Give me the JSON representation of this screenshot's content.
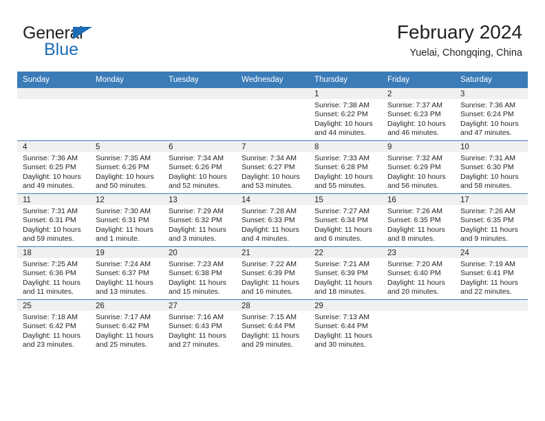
{
  "brand": {
    "name_part1": "General",
    "name_part2": "Blue",
    "triangle_color": "#1b6cb5",
    "text_color": "#231f20"
  },
  "header": {
    "title": "February 2024",
    "subtitle": "Yuelai, Chongqing, China"
  },
  "theme": {
    "header_bg": "#3b7cb8",
    "header_text": "#ffffff",
    "daynum_bg": "#f0f0f0",
    "cell_bg": "#ffffff",
    "grid_line": "#3b7cb8",
    "body_text": "#231f20"
  },
  "weekday_headers": [
    "Sunday",
    "Monday",
    "Tuesday",
    "Wednesday",
    "Thursday",
    "Friday",
    "Saturday"
  ],
  "weeks": [
    [
      {
        "day": "",
        "empty": true
      },
      {
        "day": "",
        "empty": true
      },
      {
        "day": "",
        "empty": true
      },
      {
        "day": "",
        "empty": true
      },
      {
        "day": "1",
        "sunrise": "Sunrise: 7:38 AM",
        "sunset": "Sunset: 6:22 PM",
        "daylight": "Daylight: 10 hours and 44 minutes."
      },
      {
        "day": "2",
        "sunrise": "Sunrise: 7:37 AM",
        "sunset": "Sunset: 6:23 PM",
        "daylight": "Daylight: 10 hours and 46 minutes."
      },
      {
        "day": "3",
        "sunrise": "Sunrise: 7:36 AM",
        "sunset": "Sunset: 6:24 PM",
        "daylight": "Daylight: 10 hours and 47 minutes."
      }
    ],
    [
      {
        "day": "4",
        "sunrise": "Sunrise: 7:36 AM",
        "sunset": "Sunset: 6:25 PM",
        "daylight": "Daylight: 10 hours and 49 minutes."
      },
      {
        "day": "5",
        "sunrise": "Sunrise: 7:35 AM",
        "sunset": "Sunset: 6:26 PM",
        "daylight": "Daylight: 10 hours and 50 minutes."
      },
      {
        "day": "6",
        "sunrise": "Sunrise: 7:34 AM",
        "sunset": "Sunset: 6:26 PM",
        "daylight": "Daylight: 10 hours and 52 minutes."
      },
      {
        "day": "7",
        "sunrise": "Sunrise: 7:34 AM",
        "sunset": "Sunset: 6:27 PM",
        "daylight": "Daylight: 10 hours and 53 minutes."
      },
      {
        "day": "8",
        "sunrise": "Sunrise: 7:33 AM",
        "sunset": "Sunset: 6:28 PM",
        "daylight": "Daylight: 10 hours and 55 minutes."
      },
      {
        "day": "9",
        "sunrise": "Sunrise: 7:32 AM",
        "sunset": "Sunset: 6:29 PM",
        "daylight": "Daylight: 10 hours and 56 minutes."
      },
      {
        "day": "10",
        "sunrise": "Sunrise: 7:31 AM",
        "sunset": "Sunset: 6:30 PM",
        "daylight": "Daylight: 10 hours and 58 minutes."
      }
    ],
    [
      {
        "day": "11",
        "sunrise": "Sunrise: 7:31 AM",
        "sunset": "Sunset: 6:31 PM",
        "daylight": "Daylight: 10 hours and 59 minutes."
      },
      {
        "day": "12",
        "sunrise": "Sunrise: 7:30 AM",
        "sunset": "Sunset: 6:31 PM",
        "daylight": "Daylight: 11 hours and 1 minute."
      },
      {
        "day": "13",
        "sunrise": "Sunrise: 7:29 AM",
        "sunset": "Sunset: 6:32 PM",
        "daylight": "Daylight: 11 hours and 3 minutes."
      },
      {
        "day": "14",
        "sunrise": "Sunrise: 7:28 AM",
        "sunset": "Sunset: 6:33 PM",
        "daylight": "Daylight: 11 hours and 4 minutes."
      },
      {
        "day": "15",
        "sunrise": "Sunrise: 7:27 AM",
        "sunset": "Sunset: 6:34 PM",
        "daylight": "Daylight: 11 hours and 6 minutes."
      },
      {
        "day": "16",
        "sunrise": "Sunrise: 7:26 AM",
        "sunset": "Sunset: 6:35 PM",
        "daylight": "Daylight: 11 hours and 8 minutes."
      },
      {
        "day": "17",
        "sunrise": "Sunrise: 7:26 AM",
        "sunset": "Sunset: 6:35 PM",
        "daylight": "Daylight: 11 hours and 9 minutes."
      }
    ],
    [
      {
        "day": "18",
        "sunrise": "Sunrise: 7:25 AM",
        "sunset": "Sunset: 6:36 PM",
        "daylight": "Daylight: 11 hours and 11 minutes."
      },
      {
        "day": "19",
        "sunrise": "Sunrise: 7:24 AM",
        "sunset": "Sunset: 6:37 PM",
        "daylight": "Daylight: 11 hours and 13 minutes."
      },
      {
        "day": "20",
        "sunrise": "Sunrise: 7:23 AM",
        "sunset": "Sunset: 6:38 PM",
        "daylight": "Daylight: 11 hours and 15 minutes."
      },
      {
        "day": "21",
        "sunrise": "Sunrise: 7:22 AM",
        "sunset": "Sunset: 6:39 PM",
        "daylight": "Daylight: 11 hours and 16 minutes."
      },
      {
        "day": "22",
        "sunrise": "Sunrise: 7:21 AM",
        "sunset": "Sunset: 6:39 PM",
        "daylight": "Daylight: 11 hours and 18 minutes."
      },
      {
        "day": "23",
        "sunrise": "Sunrise: 7:20 AM",
        "sunset": "Sunset: 6:40 PM",
        "daylight": "Daylight: 11 hours and 20 minutes."
      },
      {
        "day": "24",
        "sunrise": "Sunrise: 7:19 AM",
        "sunset": "Sunset: 6:41 PM",
        "daylight": "Daylight: 11 hours and 22 minutes."
      }
    ],
    [
      {
        "day": "25",
        "sunrise": "Sunrise: 7:18 AM",
        "sunset": "Sunset: 6:42 PM",
        "daylight": "Daylight: 11 hours and 23 minutes."
      },
      {
        "day": "26",
        "sunrise": "Sunrise: 7:17 AM",
        "sunset": "Sunset: 6:42 PM",
        "daylight": "Daylight: 11 hours and 25 minutes."
      },
      {
        "day": "27",
        "sunrise": "Sunrise: 7:16 AM",
        "sunset": "Sunset: 6:43 PM",
        "daylight": "Daylight: 11 hours and 27 minutes."
      },
      {
        "day": "28",
        "sunrise": "Sunrise: 7:15 AM",
        "sunset": "Sunset: 6:44 PM",
        "daylight": "Daylight: 11 hours and 29 minutes."
      },
      {
        "day": "29",
        "sunrise": "Sunrise: 7:13 AM",
        "sunset": "Sunset: 6:44 PM",
        "daylight": "Daylight: 11 hours and 30 minutes."
      },
      {
        "day": "",
        "empty": true
      },
      {
        "day": "",
        "empty": true
      }
    ]
  ]
}
